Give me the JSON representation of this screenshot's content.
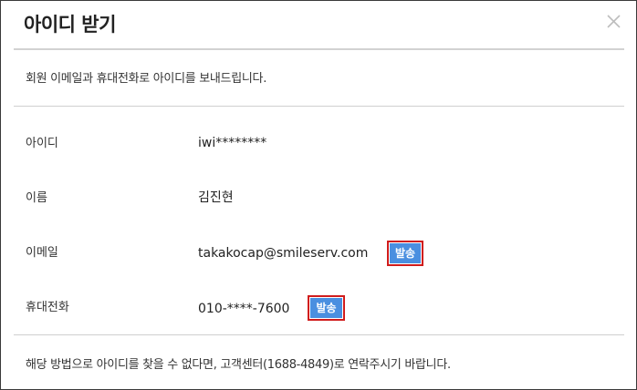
{
  "dialog": {
    "title": "아이디 받기",
    "close_icon": "close-icon"
  },
  "intro": "회원 이메일과 휴대전화로 아이디를 보내드립니다.",
  "rows": [
    {
      "label": "아이디",
      "value": "iwi********"
    },
    {
      "label": "이름",
      "value": "김진현"
    },
    {
      "label": "이메일",
      "value": "takakocap@smileserv.com",
      "button": "발송"
    },
    {
      "label": "휴대전화",
      "value": "010-****-7600",
      "button": "발송"
    }
  ],
  "footer": "해당 방법으로 아이디를 찾을 수 없다면, 고객센터(1688-4849)로 연락주시기 바랍니다.",
  "colors": {
    "button_bg": "#4a8fe0",
    "button_highlight_border": "#d01c1c",
    "divider": "#cfcfcf",
    "frame_border": "#3a3a3a"
  }
}
